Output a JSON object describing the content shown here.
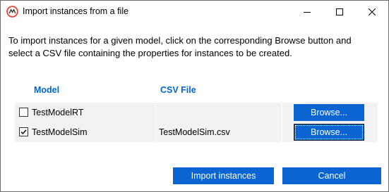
{
  "window": {
    "title": "Import instances from a file",
    "controls": [
      "minimize-icon",
      "maximize-icon",
      "close-icon"
    ]
  },
  "intro": {
    "line1": "To import instances for a given model, click on the corresponding Browse button and",
    "line2": "select a CSV file containing the properties for instances to be created."
  },
  "table": {
    "headers": {
      "model": "Model",
      "csv": "CSV File"
    },
    "rows": [
      {
        "checked": false,
        "model": "TestModelRT",
        "csv": "",
        "browse_label": "Browse..."
      },
      {
        "checked": true,
        "model": "TestModelSim",
        "csv": "TestModelSim.csv",
        "browse_label": "Browse..."
      }
    ]
  },
  "actions": {
    "import_label": "Import instances",
    "cancel_label": "Cancel"
  },
  "colors": {
    "accent": "#0a64d2",
    "header_text": "#0066cc",
    "row_background": "#f2f2f2",
    "app_icon": "#e8442d"
  }
}
